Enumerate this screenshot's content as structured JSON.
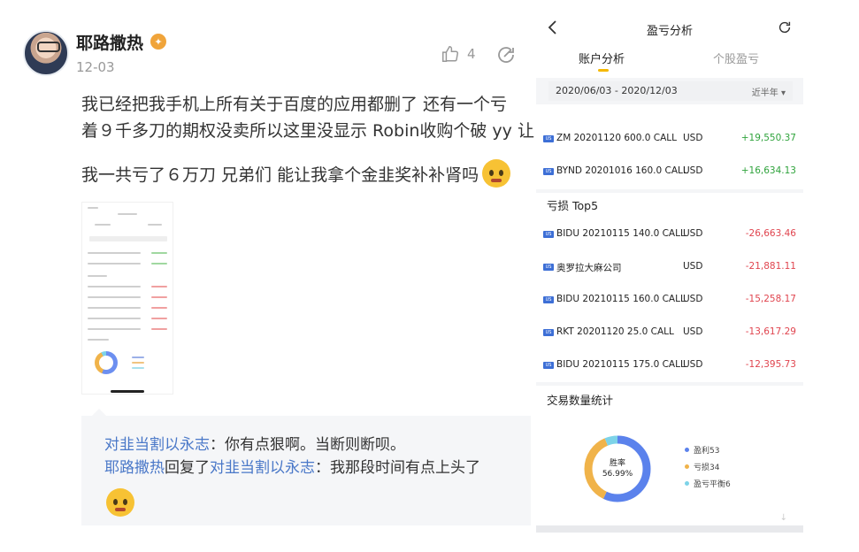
{
  "post": {
    "author": "耶路撒热",
    "date": "12-03",
    "likes": "4",
    "line1": "我已经把我手机上所有关于百度的应用都删了 还有一个亏",
    "line2": "着９千多刀的期权没卖所以这里没显示 Robin收购个破 yy 让",
    "line3": "我一共亏了６万刀 兄弟们 能让我拿个金韭奖补补肾吗",
    "icons": {
      "vip": "vip-badge-icon",
      "like": "thumbs-up-icon",
      "share": "share-icon",
      "emoji": "crying-emoji-icon"
    }
  },
  "comments": [
    {
      "user": "对韭当割以永志",
      "separator": "：",
      "text": "你有点狠啊。当断则断呗。"
    },
    {
      "user": "耶路撒热",
      "reply_word": "回复了",
      "target": "对韭当割以永志",
      "separator": "：",
      "text": "我那段时间有点上头了"
    }
  ],
  "app": {
    "title": "盈亏分析",
    "tabs": [
      "账户分析",
      "个股盈亏"
    ],
    "active_tab": "账户分析",
    "date_range": "2020/06/03 - 2020/12/03",
    "range_select": "近半年",
    "gainers": [
      {
        "badge": "US",
        "name": "ZM 20201120 600.0 CALL",
        "currency": "USD",
        "value": "+19,550.37"
      },
      {
        "badge": "US",
        "name": "BYND 20201016 160.0 CALL",
        "currency": "USD",
        "value": "+16,634.13"
      }
    ],
    "loss_title": "亏损 Top5",
    "losers": [
      {
        "badge": "US",
        "name": "BIDU 20210115 140.0 CALL",
        "currency": "USD",
        "value": "-26,663.46"
      },
      {
        "badge": "US",
        "name": "奥罗拉大麻公司",
        "currency": "USD",
        "value": "-21,881.11"
      },
      {
        "badge": "US",
        "name": "BIDU 20210115 160.0 CALL",
        "currency": "USD",
        "value": "-15,258.17"
      },
      {
        "badge": "US",
        "name": "RKT 20201120 25.0 CALL",
        "currency": "USD",
        "value": "-13,617.29"
      },
      {
        "badge": "US",
        "name": "BIDU 20210115 175.0 CALL",
        "currency": "USD",
        "value": "-12,395.73"
      }
    ],
    "stats_title": "交易数量统计",
    "donut": {
      "label": "胜率",
      "value": "56.99%",
      "segments": [
        {
          "label": "盈利53",
          "count": 53,
          "color": "#5b82ec"
        },
        {
          "label": "亏损34",
          "count": 34,
          "color": "#f0b34a"
        },
        {
          "label": "盈亏平衡6",
          "count": 6,
          "color": "#7dd3e8"
        }
      ]
    },
    "colors": {
      "positive": "#2fa33c",
      "negative": "#e0454f",
      "accent": "#f5b800"
    }
  }
}
